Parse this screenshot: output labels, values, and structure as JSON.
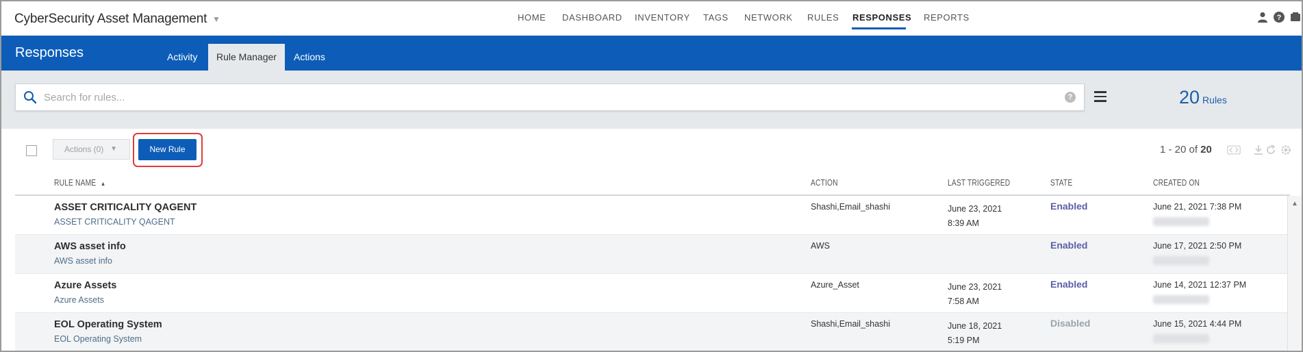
{
  "app": {
    "title": "CyberSecurity Asset Management",
    "caret": "▼"
  },
  "nav": {
    "items": [
      "HOME",
      "DASHBOARD",
      "INVENTORY",
      "TAGS",
      "NETWORK",
      "RULES",
      "RESPONSES",
      "REPORTS"
    ],
    "active": "RESPONSES"
  },
  "header": {
    "section_title": "Responses",
    "tabs": [
      "Activity",
      "Rule Manager",
      "Actions"
    ],
    "active_tab": "Rule Manager"
  },
  "search": {
    "placeholder": "Search for rules...",
    "value": "",
    "help_glyph": "?"
  },
  "summary": {
    "count": "20",
    "label": "Rules"
  },
  "toolbar": {
    "actions_label": "Actions (0)",
    "actions_caret": "▼",
    "new_rule_label": "New Rule",
    "pager_range": "1 - 20 of",
    "pager_total": "20"
  },
  "table": {
    "columns": {
      "name": "RULE NAME",
      "name_sort": "▲",
      "action": "ACTION",
      "last_triggered": "LAST TRIGGERED",
      "state": "STATE",
      "created_on": "CREATED ON"
    },
    "rows": [
      {
        "name": "ASSET CRITICALITY QAGENT",
        "description": "ASSET CRITICALITY QAGENT",
        "action": "Shashi,Email_shashi",
        "last_triggered_date": "June 23, 2021",
        "last_triggered_time": "8:39 AM",
        "state": "Enabled",
        "created_on": "June 21, 2021 7:38 PM"
      },
      {
        "name": "AWS asset info",
        "description": "AWS asset info",
        "action": "AWS",
        "last_triggered_date": "",
        "last_triggered_time": "",
        "state": "Enabled",
        "created_on": "June 17, 2021 2:50 PM"
      },
      {
        "name": "Azure Assets",
        "description": "Azure Assets",
        "action": "Azure_Asset",
        "last_triggered_date": "June 23, 2021",
        "last_triggered_time": "7:58 AM",
        "state": "Enabled",
        "created_on": "June 14, 2021 12:37 PM"
      },
      {
        "name": "EOL Operating System",
        "description": "EOL Operating System",
        "action": "Shashi,Email_shashi",
        "last_triggered_date": "June 18, 2021",
        "last_triggered_time": "5:19 PM",
        "state": "Disabled",
        "created_on": "June 15, 2021 4:44 PM"
      }
    ]
  },
  "colors": {
    "brand_blue": "#0d5db8",
    "enabled": "#5b5ea6",
    "disabled": "#9aa3ad",
    "highlight": "#e03a3a"
  }
}
